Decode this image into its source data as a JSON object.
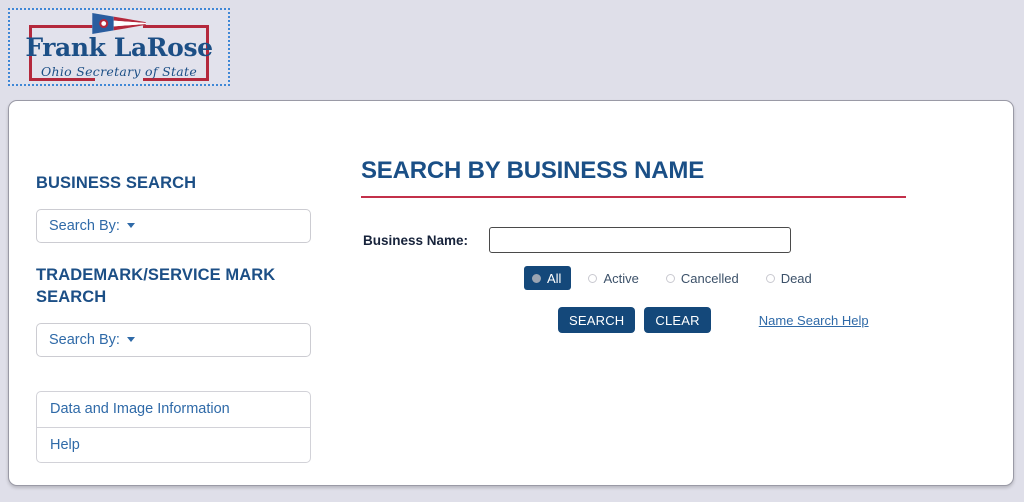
{
  "header": {
    "logo": {
      "name": "Frank LaRose",
      "subtitle": "Ohio Secretary of State",
      "flag_icon": "ohio-flag-burgee-icon"
    }
  },
  "sidebar": {
    "business_search": {
      "heading": "BUSINESS SEARCH",
      "select_label": "Search By:",
      "caret_icon": "chevron-down-icon"
    },
    "trademark_search": {
      "heading": "TRADEMARK/SERVICE MARK SEARCH",
      "select_label": "Search By:",
      "caret_icon": "chevron-down-icon"
    },
    "links": [
      {
        "label": "Data and Image Information"
      },
      {
        "label": "Help"
      }
    ]
  },
  "main": {
    "title": "SEARCH BY BUSINESS NAME",
    "form": {
      "business_name_label": "Business Name:",
      "business_name_value": "",
      "business_name_placeholder": ""
    },
    "status_filters": [
      {
        "label": "All",
        "selected": true
      },
      {
        "label": "Active",
        "selected": false
      },
      {
        "label": "Cancelled",
        "selected": false
      },
      {
        "label": "Dead",
        "selected": false
      }
    ],
    "buttons": {
      "search": "SEARCH",
      "clear": "CLEAR"
    },
    "help_link": "Name Search Help"
  },
  "colors": {
    "page_background": "#dfdfe9",
    "brand_navy": "#1c4f86",
    "brand_red": "#c3304a",
    "button_blue": "#14487a",
    "link_blue": "#2f6aa8"
  }
}
